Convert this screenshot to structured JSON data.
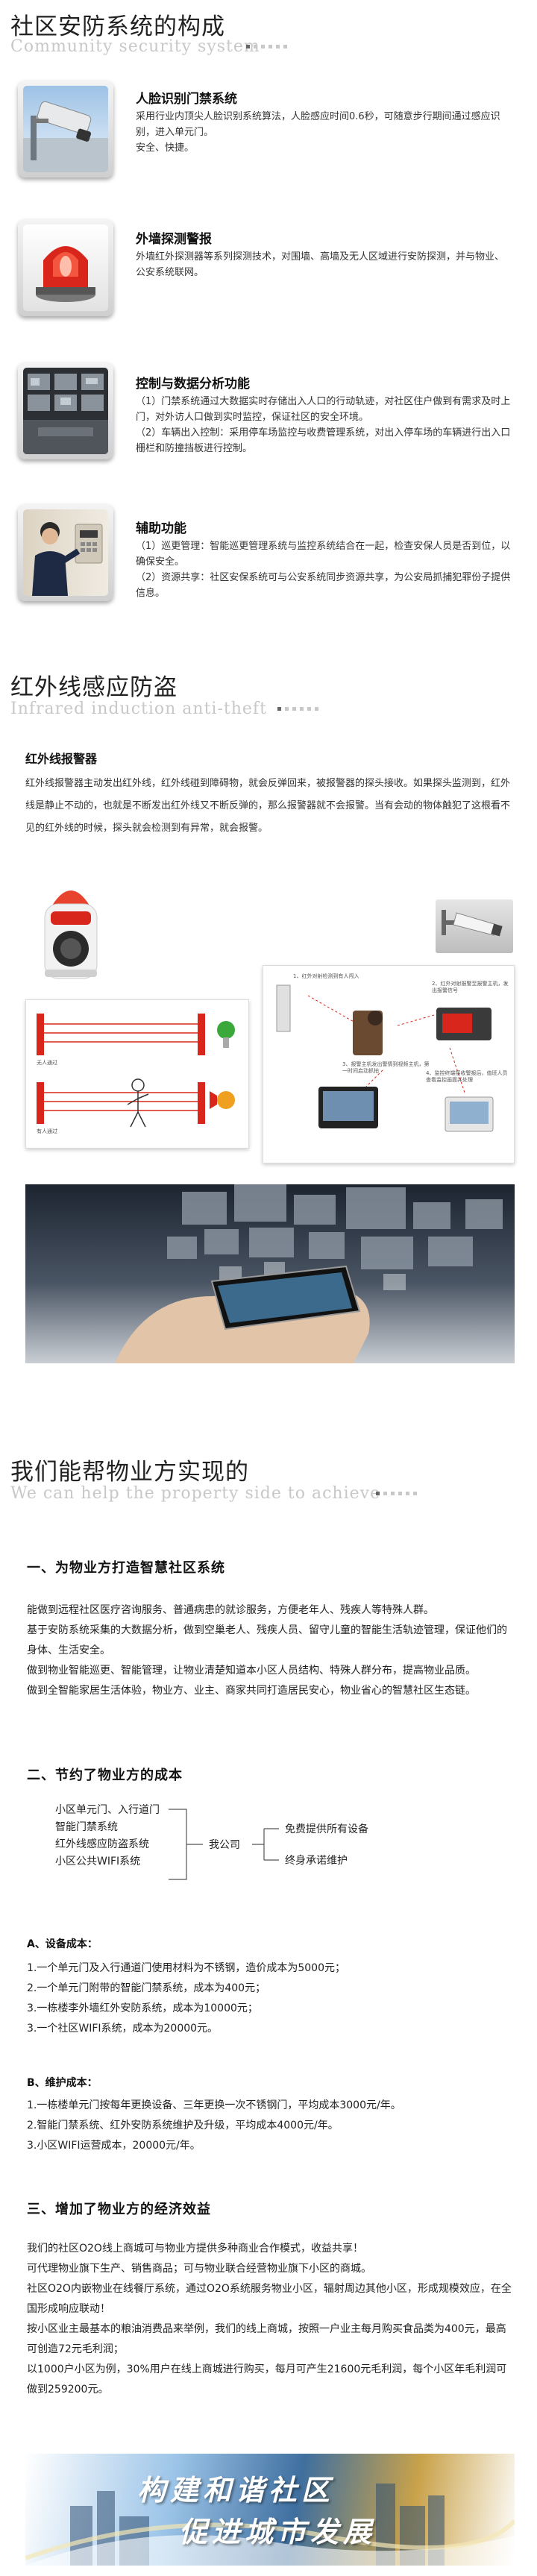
{
  "s1": {
    "title": "社区安防系统的构成",
    "subtitle": "Community security system",
    "features": [
      {
        "title": "人脸识别门禁系统",
        "desc": "采用行业内顶尖人脸识别系统算法，人脸感应时间0.6秒，可随意步行期间通过感应识别，进入单元门。",
        "desc2": "安全、快捷。",
        "icon": "surveillance-camera-icon"
      },
      {
        "title": "外墙探测警报",
        "desc": "外墙红外探测器等系列探测技术，对围墙、高墙及无人区域进行安防探测，并与物业、公安系统联网。",
        "icon": "red-alarm-siren-icon"
      },
      {
        "title": "控制与数据分析功能",
        "desc": "（1）门禁系统通过大数据实时存储出入人口的行动轨迹，对社区住户做到有需求及时上门，对外访人口做到实时监控，保证社区的安全环境。",
        "desc2": "（2）车辆出入控制：采用停车场监控与收费管理系统，对出入停车场的车辆进行出入口栅栏和防撞挡板进行控制。",
        "icon": "cctv-monitor-wall-icon"
      },
      {
        "title": "辅助功能",
        "desc": "（1）巡更管理：智能巡更管理系统与监控系统结合在一起，检查安保人员是否到位，以确保安全。",
        "desc2": "（2）资源共享：社区安保系统可与公安系统同步资源共享，为公安局抓捕犯罪份子提供信息。",
        "icon": "guard-at-keypad-icon"
      }
    ]
  },
  "s2": {
    "title": "红外线感应防盗",
    "subtitle": "Infrared induction anti-theft",
    "heading": "红外线报警器",
    "body": "红外线报警器主动发出红外线，红外线碰到障碍物，就会反弹回来，被报警器的探头接收。如果探头监测到，红外线是静止不动的，也就是不断发出红外线又不断反弹的，那么报警器就不会报警。当有会动的物体触犯了这根看不见的红外线的时候，探头就会检测到有异常，就会报警。",
    "diagram": {
      "step1": "1、红外对射检测到有人闯入",
      "step2": "2、红外对射报警至报警主机，发出报警信号",
      "step3": "3、报警主机发出警情到视频主机，第一时间启动抓拍",
      "step4": "4、监控终端接收警报后，值班人员查看监控画面并处理",
      "left_top": "无人通过",
      "left_bottom": "有人通过"
    }
  },
  "s3": {
    "title": "我们能帮物业方实现的",
    "subtitle": "We can help the property side to achieve",
    "h1": "一、为物业方打造智慧社区系统",
    "p1": [
      "能做到远程社区医疗咨询服务、普通病患的就诊服务，方便老年人、残疾人等特殊人群。",
      "基于安防系统采集的大数据分析，做到空巢老人、残疾人员、留守儿童的智能生活轨迹管理，保证他们的身体、生活安全。",
      "做到物业智能巡更、智能管理，让物业清楚知道本小区人员结构、特殊人群分布，提高物业品质。",
      "做到全智能家居生活体验，物业方、业主、商家共同打造居民安心，物业省心的智慧社区生态链。"
    ],
    "h2": "二、节约了物业方的成本",
    "tree_left": [
      "小区单元门、入行道门",
      "智能门禁系统",
      "红外线感应防盗系统",
      "小区公共WIFI系统"
    ],
    "tree_mid": "我公司",
    "tree_right": [
      "免费提供所有设备",
      "终身承诺维护"
    ],
    "h_a": "A、设备成本：",
    "list_a": [
      "1.一个单元门及入行通道门使用材料为不锈钢，造价成本为5000元；",
      "2.一个单元门附带的智能门禁系统，成本为400元；",
      "3.一栋楼李外墙红外安防系统，成本为10000元；",
      "3.一个社区WIFI系统，成本为20000元。"
    ],
    "h_b": "B、维护成本：",
    "list_b": [
      "1.一栋楼单元门按每年更换设备、三年更换一次不锈钢门，平均成本3000元/年。",
      "2.智能门禁系统、红外安防系统维护及升级，平均成本4000元/年。",
      "3.小区WIFI运营成本，20000元/年。"
    ],
    "h3": "三、增加了物业方的经济效益",
    "p3": [
      "我们的社区O2O线上商城可与物业方提供多种商业合作模式，收益共享！",
      "可代理物业旗下生产、销售商品；可与物业联合经营物业旗下小区的商城。",
      "社区O2O内嵌物业在线餐厅系统，通过O2O系统服务物业小区，辐射周边其他小区，形成规模效应，在全国形成响应联动！",
      "按小区业主最基本的粮油消费品来举例，我们的线上商城，按照一户业主每月购买食品类为400元，最高可创造72元毛利润；",
      "以1000户小区为例，30%用户在线上商城进行购买，每月可产生21600元毛利润，每个小区年毛利润可做到259200元。"
    ]
  },
  "banner": {
    "line1": "构建和谐社区",
    "line2": "促进城市发展"
  },
  "colors": {
    "accent_red": "#d9261c",
    "subtitle_gray": "#c8c8c8",
    "banner_white": "#ffffff"
  }
}
